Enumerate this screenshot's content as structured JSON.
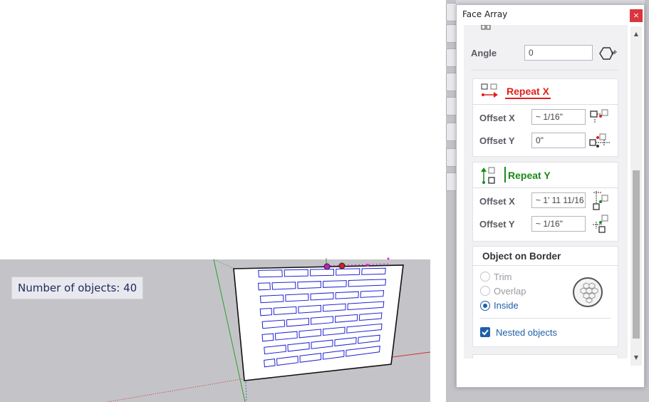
{
  "viewport": {
    "object_count_label": "Number of objects: 40"
  },
  "dialog": {
    "title": "Face Array",
    "close_glyph": "×",
    "angle": {
      "label": "Angle",
      "value": "0"
    },
    "repeat_x": {
      "title": "Repeat X",
      "offset_x": {
        "label": "Offset X",
        "value": "~ 1/16\""
      },
      "offset_y": {
        "label": "Offset Y",
        "value": "0\""
      }
    },
    "repeat_y": {
      "title": "Repeat Y",
      "offset_x": {
        "label": "Offset X",
        "value": "~ 1' 11 11/16"
      },
      "offset_y": {
        "label": "Offset Y",
        "value": "~ 1/16\""
      }
    },
    "object_on_border": {
      "title": "Object on Border",
      "options": [
        "Trim",
        "Overlap",
        "Inside"
      ],
      "selected": "Inside"
    },
    "nested_objects": {
      "label": "Nested objects",
      "checked": true
    }
  },
  "colors": {
    "repeat_x_accent": "#e0201c",
    "repeat_y_accent": "#1a8a1a",
    "selection_blue": "#1f5fa8",
    "brick_outline": "#2222d4",
    "ground": "#c4c4c8"
  },
  "icons": [
    "rotate-center-icon",
    "repeat-x-icon",
    "repeat-y-icon",
    "offset-x-icon",
    "offset-y-icon",
    "hex-pattern-icon",
    "checkbox-icon",
    "close-icon"
  ]
}
